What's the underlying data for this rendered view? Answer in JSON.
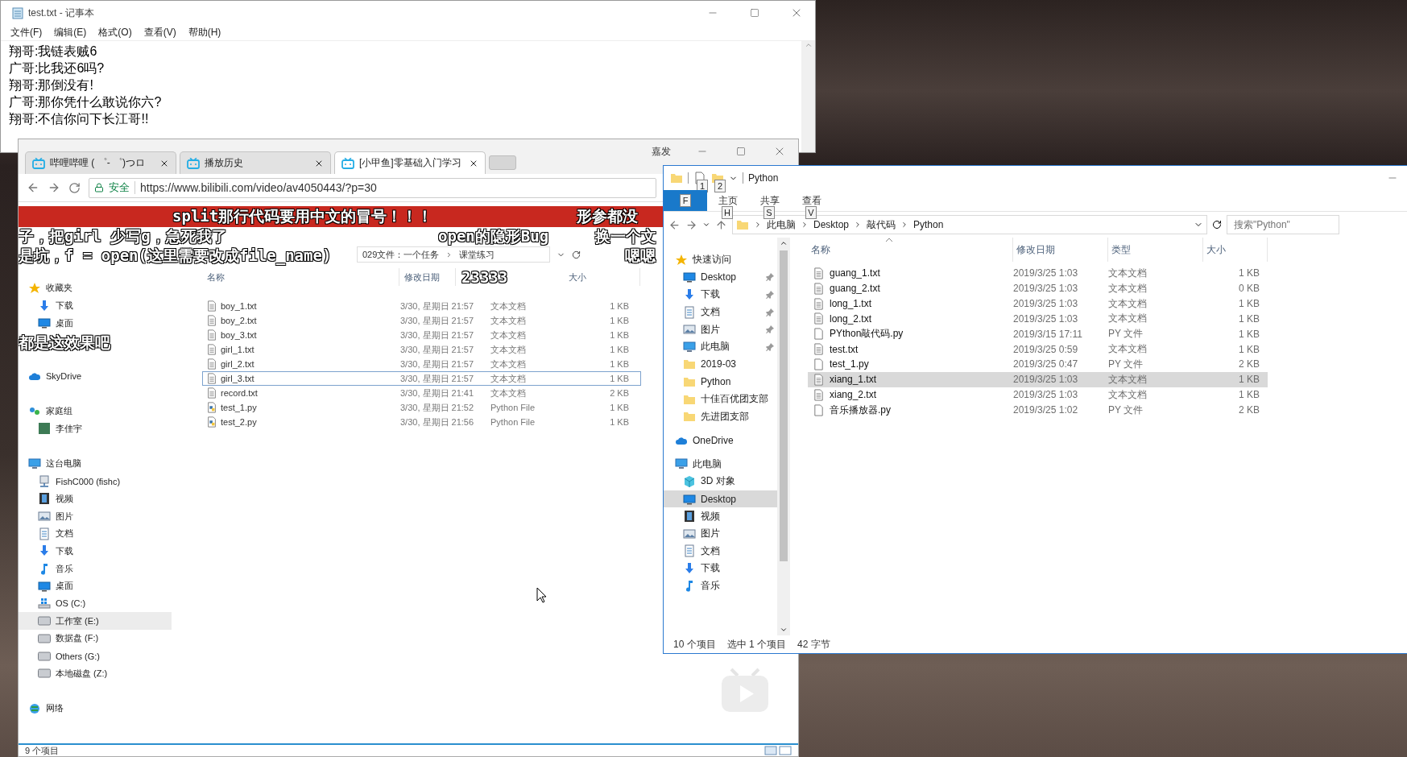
{
  "notepad": {
    "title": "test.txt - 记事本",
    "menu": [
      "文件(F)",
      "编辑(E)",
      "格式(O)",
      "查看(V)",
      "帮助(H)"
    ],
    "lines": [
      "翔哥:我链表贼6",
      "广哥:比我还6吗?",
      "翔哥:那倒没有!",
      "广哥:那你凭什么敢说你六?",
      "翔哥:不信你问下长江哥!!"
    ]
  },
  "browser": {
    "caption": "嘉发",
    "tabs": [
      {
        "label": "哔哩哔哩 ( ゜- ゜)つロ",
        "selected": false
      },
      {
        "label": "播放历史",
        "selected": false
      },
      {
        "label": "[小甲鱼]零基础入门学习",
        "selected": true
      }
    ],
    "security": "安全",
    "url": "https://www.bilibili.com/video/av4050443/?p=30",
    "page": {
      "breadcrumb": [
        "029文件：一个任务",
        "课堂练习"
      ],
      "columns": [
        "名称",
        "修改日期",
        "大小"
      ],
      "tree": [
        {
          "label": "收藏夹",
          "kind": "star",
          "selected": false,
          "children": [
            {
              "label": "下载",
              "kind": "download",
              "selected": false
            },
            {
              "label": "桌面",
              "kind": "desktop",
              "selected": false
            }
          ]
        },
        {
          "label": "SkyDrive",
          "kind": "cloud",
          "selected": false
        },
        {
          "label": "家庭组",
          "kind": "group",
          "selected": false,
          "children": [
            {
              "label": "李佳宇",
              "kind": "user",
              "selected": false
            }
          ]
        },
        {
          "label": "这台电脑",
          "kind": "pc",
          "selected": false,
          "children": [
            {
              "label": "FishC000 (fishc)",
              "kind": "netdrive",
              "selected": false
            },
            {
              "label": "视频",
              "kind": "videos",
              "selected": false
            },
            {
              "label": "图片",
              "kind": "pictures",
              "selected": false
            },
            {
              "label": "文档",
              "kind": "docs",
              "selected": false
            },
            {
              "label": "下载",
              "kind": "download",
              "selected": false
            },
            {
              "label": "音乐",
              "kind": "music",
              "selected": false
            },
            {
              "label": "桌面",
              "kind": "desktop",
              "selected": false
            },
            {
              "label": "OS (C:)",
              "kind": "os",
              "selected": false
            },
            {
              "label": "工作室 (E:)",
              "kind": "drive",
              "selected": true
            },
            {
              "label": "数据盘 (F:)",
              "kind": "drive",
              "selected": false
            },
            {
              "label": "Others (G:)",
              "kind": "drive",
              "selected": false
            },
            {
              "label": "本地磁盘 (Z:)",
              "kind": "drive",
              "selected": false
            }
          ]
        },
        {
          "label": "网络",
          "kind": "network",
          "selected": false
        }
      ],
      "files": [
        {
          "name": "boy_1.txt",
          "kind": "txt",
          "date": "3/30, 星期日 21:57",
          "type": "文本文档",
          "size": "1 KB",
          "selected": false
        },
        {
          "name": "boy_2.txt",
          "kind": "txt",
          "date": "3/30, 星期日 21:57",
          "type": "文本文档",
          "size": "1 KB",
          "selected": false
        },
        {
          "name": "boy_3.txt",
          "kind": "txt",
          "date": "3/30, 星期日 21:57",
          "type": "文本文档",
          "size": "1 KB",
          "selected": false
        },
        {
          "name": "girl_1.txt",
          "kind": "txt",
          "date": "3/30, 星期日 21:57",
          "type": "文本文档",
          "size": "1 KB",
          "selected": false
        },
        {
          "name": "girl_2.txt",
          "kind": "txt",
          "date": "3/30, 星期日 21:57",
          "type": "文本文档",
          "size": "1 KB",
          "selected": false
        },
        {
          "name": "girl_3.txt",
          "kind": "txt",
          "date": "3/30, 星期日 21:57",
          "type": "文本文档",
          "size": "1 KB",
          "selected": true
        },
        {
          "name": "record.txt",
          "kind": "txt",
          "date": "3/30, 星期日 21:41",
          "type": "文本文档",
          "size": "2 KB",
          "selected": false
        },
        {
          "name": "test_1.py",
          "kind": "py",
          "date": "3/30, 星期日 21:52",
          "type": "Python File",
          "size": "1 KB",
          "selected": false
        },
        {
          "name": "test_2.py",
          "kind": "py",
          "date": "3/30, 星期日 21:56",
          "type": "Python File",
          "size": "1 KB",
          "selected": false
        }
      ],
      "status": "9 个项目"
    }
  },
  "danmaku": [
    "split那行代码要用中文的冒号！！！",
    "形参都没",
    "子，把girl 少写g，急死我了",
    "open的隐形Bug",
    "换一个文",
    "是坑，f = open(这里需要改成file_name)",
    "嗯嗯",
    "23333",
    "都是这效果吧"
  ],
  "explorer": {
    "title": "Python",
    "quick_keytips": [
      "1",
      "2"
    ],
    "file_tab_keytip": "F",
    "tabs": [
      {
        "label": "主页",
        "keytip": "H"
      },
      {
        "label": "共享",
        "keytip": "S"
      },
      {
        "label": "查看",
        "keytip": "V"
      }
    ],
    "crumbs": [
      "此电脑",
      "Desktop",
      "敲代码",
      "Python"
    ],
    "search_placeholder": "搜索\"Python\"",
    "columns": [
      "名称",
      "修改日期",
      "类型",
      "大小"
    ],
    "nav": [
      {
        "label": "快速访问",
        "kind": "star",
        "selected": false,
        "children": [
          {
            "label": "Desktop",
            "kind": "desktop",
            "selected": false,
            "pinned": true
          },
          {
            "label": "下载",
            "kind": "download",
            "selected": false,
            "pinned": true
          },
          {
            "label": "文档",
            "kind": "docs",
            "selected": false,
            "pinned": true
          },
          {
            "label": "图片",
            "kind": "pictures",
            "selected": false,
            "pinned": true
          },
          {
            "label": "此电脑",
            "kind": "pc",
            "selected": false,
            "pinned": true
          },
          {
            "label": "2019-03",
            "kind": "folder",
            "selected": false,
            "pinned": false
          },
          {
            "label": "Python",
            "kind": "folder",
            "selected": false,
            "pinned": false
          },
          {
            "label": "十佳百优团支部",
            "kind": "folder",
            "selected": false,
            "pinned": false
          },
          {
            "label": "先进团支部",
            "kind": "folder",
            "selected": false,
            "pinned": false
          }
        ]
      },
      {
        "label": "OneDrive",
        "kind": "cloud",
        "selected": false
      },
      {
        "label": "此电脑",
        "kind": "pc",
        "selected": false,
        "children": [
          {
            "label": "3D 对象",
            "kind": "cube",
            "selected": false
          },
          {
            "label": "Desktop",
            "kind": "desktop",
            "selected": true
          },
          {
            "label": "视频",
            "kind": "videos",
            "selected": false
          },
          {
            "label": "图片",
            "kind": "pictures",
            "selected": false
          },
          {
            "label": "文档",
            "kind": "docs",
            "selected": false
          },
          {
            "label": "下载",
            "kind": "download",
            "selected": false
          },
          {
            "label": "音乐",
            "kind": "music",
            "selected": false
          }
        ]
      }
    ],
    "files": [
      {
        "name": "guang_1.txt",
        "kind": "txt",
        "date": "2019/3/25 1:03",
        "type": "文本文档",
        "size": "1 KB",
        "selected": false
      },
      {
        "name": "guang_2.txt",
        "kind": "txt",
        "date": "2019/3/25 1:03",
        "type": "文本文档",
        "size": "0 KB",
        "selected": false
      },
      {
        "name": "long_1.txt",
        "kind": "txt",
        "date": "2019/3/25 1:03",
        "type": "文本文档",
        "size": "1 KB",
        "selected": false
      },
      {
        "name": "long_2.txt",
        "kind": "txt",
        "date": "2019/3/25 1:03",
        "type": "文本文档",
        "size": "1 KB",
        "selected": false
      },
      {
        "name": "PYthon敲代码.py",
        "kind": "file",
        "date": "2019/3/15 17:11",
        "type": "PY 文件",
        "size": "1 KB",
        "selected": false
      },
      {
        "name": "test.txt",
        "kind": "txt",
        "date": "2019/3/25 0:59",
        "type": "文本文档",
        "size": "1 KB",
        "selected": false
      },
      {
        "name": "test_1.py",
        "kind": "file",
        "date": "2019/3/25 0:47",
        "type": "PY 文件",
        "size": "2 KB",
        "selected": false
      },
      {
        "name": "xiang_1.txt",
        "kind": "txt",
        "date": "2019/3/25 1:03",
        "type": "文本文档",
        "size": "1 KB",
        "selected": true
      },
      {
        "name": "xiang_2.txt",
        "kind": "txt",
        "date": "2019/3/25 1:03",
        "type": "文本文档",
        "size": "1 KB",
        "selected": false
      },
      {
        "name": "音乐播放器.py",
        "kind": "file",
        "date": "2019/3/25 1:02",
        "type": "PY 文件",
        "size": "2 KB",
        "selected": false
      }
    ],
    "status": [
      "10 个项目",
      "选中 1 个项目",
      "42 字节"
    ]
  }
}
